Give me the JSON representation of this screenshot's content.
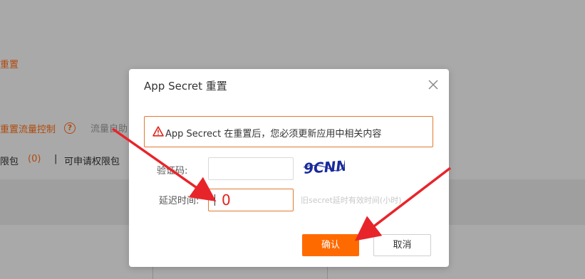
{
  "background": {
    "reset_link": "重置",
    "traffic_control": "重置流量控制",
    "help_icon": "?",
    "traffic_auto": "流量自助",
    "limit_pack_label": "限包",
    "limit_pack_count": "(0)",
    "separator": "|",
    "apply_limit": "可申请权限包"
  },
  "dialog": {
    "title": "App Secret 重置",
    "alert_text": "App Secrect 在重置后，您必须更新应用中相关内容",
    "captcha_label": "验证码:",
    "captcha_value": "",
    "captcha_image_text": "9CNN",
    "delay_label": "延迟时间:",
    "delay_value": "0",
    "delay_hint": "旧secret延时有效时间(小时)",
    "confirm_label": "确认",
    "cancel_label": "取消"
  },
  "colors": {
    "accent": "#ff6a00",
    "alert_border": "#e07a2f",
    "arrow": "#e8242b"
  }
}
